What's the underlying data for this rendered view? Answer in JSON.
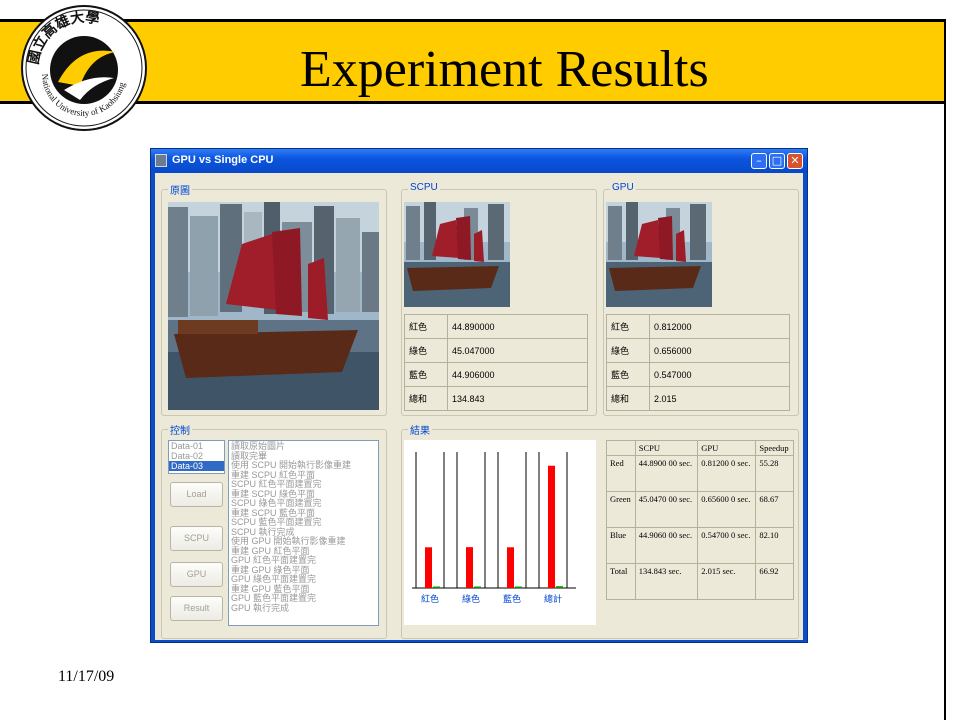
{
  "slide": {
    "title": "Experiment Results",
    "date": "11/17/09",
    "logo_text": "國立高雄大學 National University of Kaohsiung",
    "accent_color": "#ffcc00"
  },
  "window": {
    "title": "GPU vs Single CPU",
    "controls": [
      "minimize",
      "maximize",
      "close"
    ]
  },
  "original_group": {
    "label": "原圖"
  },
  "scpu_group": {
    "label": "SCPU",
    "rows": [
      {
        "label": "紅色",
        "value": "44.890000"
      },
      {
        "label": "綠色",
        "value": "45.047000"
      },
      {
        "label": "藍色",
        "value": "44.906000"
      },
      {
        "label": "總和",
        "value": "134.843"
      }
    ]
  },
  "gpu_group": {
    "label": "GPU",
    "rows": [
      {
        "label": "紅色",
        "value": "0.812000"
      },
      {
        "label": "綠色",
        "value": "0.656000"
      },
      {
        "label": "藍色",
        "value": "0.547000"
      },
      {
        "label": "總和",
        "value": "2.015"
      }
    ]
  },
  "control_group": {
    "label": "控制",
    "datasets": [
      "Data-01",
      "Data-02",
      "Data-03"
    ],
    "selected_dataset": "Data-03",
    "log": [
      "讀取原始圖片",
      "讀取完畢",
      "使用 SCPU 開始執行影像重建",
      "重建 SCPU 紅色平面",
      "SCPU 紅色平面建置完",
      "重建 SCPU 綠色平面",
      "SCPU 綠色平面建置完",
      "重建 SCPU 藍色平面",
      "SCPU 藍色平面建置完",
      "SCPU 執行完成",
      "使用 GPU 開始執行影像重建",
      "重建 GPU 紅色平面",
      "GPU 紅色平面建置完",
      "重建 GPU 綠色平面",
      "GPU 綠色平面建置完",
      "重建 GPU 藍色平面",
      "GPU 藍色平面建置完",
      "GPU 執行完成"
    ],
    "buttons": {
      "load": "Load",
      "scpu": "SCPU",
      "gpu": "GPU",
      "result": "Result"
    }
  },
  "results_group": {
    "label": "結果",
    "table": {
      "headers": [
        "",
        "SCPU",
        "GPU",
        "Speedup"
      ],
      "rows": [
        {
          "name": "Red",
          "scpu": "44.8900 00 sec.",
          "gpu": "0.81200 0 sec.",
          "speedup": "55.28"
        },
        {
          "name": "Green",
          "scpu": "45.0470 00 sec.",
          "gpu": "0.65600 0 sec.",
          "speedup": "68.67"
        },
        {
          "name": "Blue",
          "scpu": "44.9060 00 sec.",
          "gpu": "0.54700 0 sec.",
          "speedup": "82.10"
        },
        {
          "name": "Total",
          "scpu": "134.843 sec.",
          "gpu": "2.015 sec.",
          "speedup": "66.92"
        }
      ]
    }
  },
  "chart_data": {
    "type": "bar",
    "categories": [
      "紅色",
      "綠色",
      "藍色",
      "總計"
    ],
    "series": [
      {
        "values": [
          44.89,
          45.047,
          44.906,
          134.843
        ],
        "color": "#ff0000"
      },
      {
        "values": [
          0.812,
          0.656,
          0.547,
          2.015
        ],
        "color": "#00a000"
      }
    ],
    "ylim": [
      0,
      150
    ],
    "grid": false
  }
}
